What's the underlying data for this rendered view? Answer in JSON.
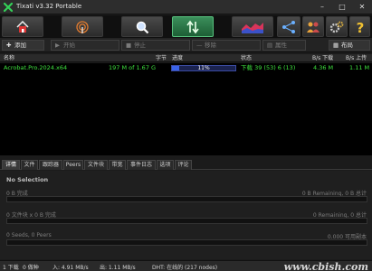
{
  "window": {
    "title": "Tixati v3.32 Portable",
    "minimize": "–",
    "maximize": "□",
    "close": "✕"
  },
  "toolbar": {
    "buttons": [
      "home",
      "bandwidth",
      "search",
      "transfers",
      "graphs",
      "connections",
      "users",
      "settings",
      "help"
    ]
  },
  "actions": {
    "add": "添加",
    "start": "开始",
    "stop": "停止",
    "remove": "移除",
    "properties": "属性",
    "layout": "布局"
  },
  "list": {
    "columns": [
      "名称",
      "字节",
      "进度",
      "状态",
      "B/s 下载",
      "B/s 上传"
    ],
    "rows": [
      {
        "name": "Acrobat.Pro.2024.x64",
        "bytes": "197 M of 1.67 G",
        "progress_pct": 11,
        "progress_label": "11%",
        "status": "下载 39 (53) 6 (13)",
        "down": "4.36 M",
        "up": "1.11 M"
      }
    ]
  },
  "tabs": [
    "详情",
    "文件",
    "跟踪器",
    "Peers",
    "文件块",
    "带宽",
    "事件日志",
    "选项",
    "评论"
  ],
  "details": {
    "no_selection": "No Selection",
    "line1_left": "0 B 完成",
    "line1_right": "0 B Remaining,  0 B 总计",
    "line2_left": "0 文件块  x  0 B 完成",
    "line2_right": "0 Remaining,  0 总计",
    "line3_left": "0 Seeds, 0 Peers",
    "line3_right": "0.000 可用副本"
  },
  "status": {
    "downloads": "1 下载",
    "seeds": "0 做种",
    "in": "入: 4.91 MB/s",
    "out": "出: 1.11 MB/s",
    "dht": "DHT: 在线的 (217 nodes)",
    "watermark": "www.cbish.com"
  }
}
